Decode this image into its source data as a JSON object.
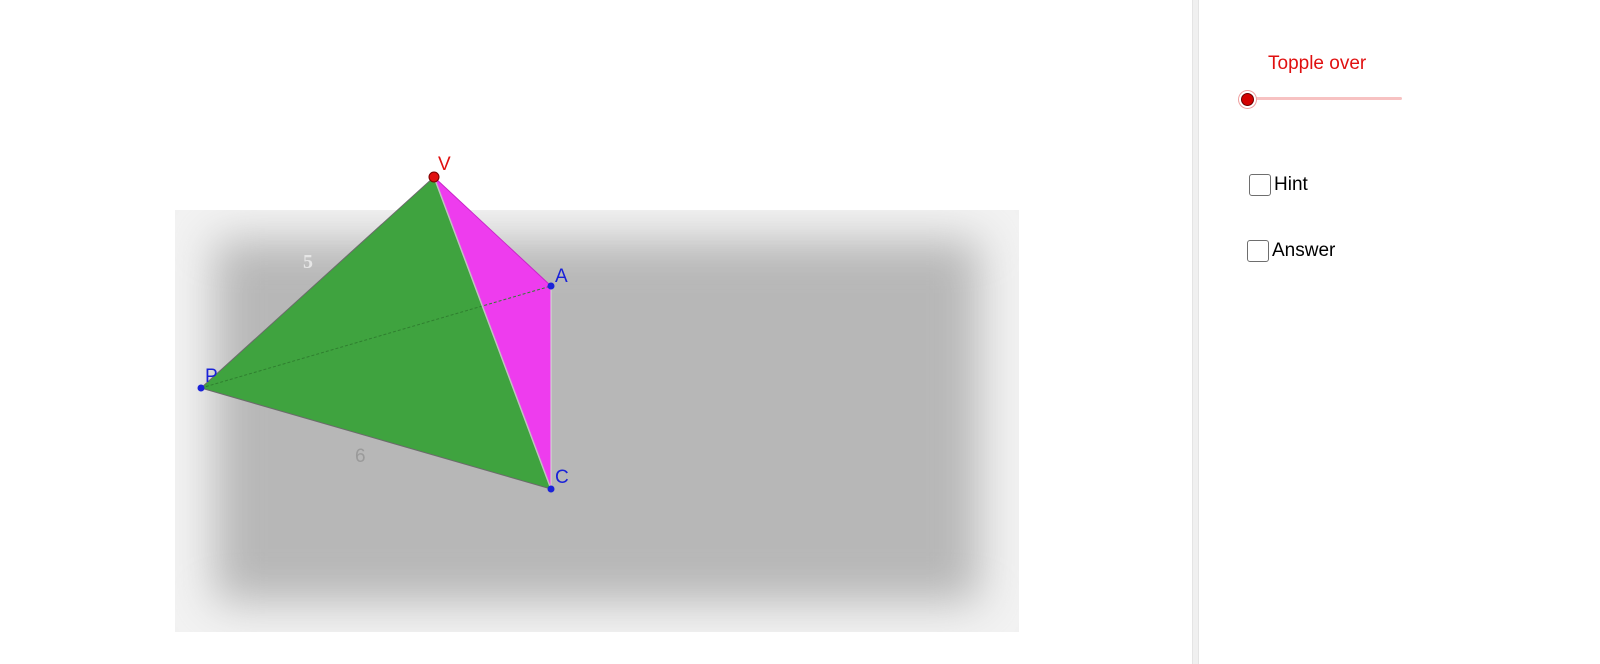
{
  "scene": {
    "edge_labels": {
      "vp": "5",
      "pc": "6"
    },
    "vertex_labels": {
      "v": "V",
      "a": "A",
      "p": "P",
      "c": "C"
    },
    "colors": {
      "front_face": "#3fa33f",
      "side_face": "#ee3cee",
      "base_plane": "#b7b7b7",
      "vertex_label_blue": "#1a22d8",
      "vertex_label_red": "#e01010",
      "edge_label_gray": "#9a9a9a"
    }
  },
  "controls": {
    "slider": {
      "label": "Topple over",
      "value": 0
    },
    "hint": {
      "label": "Hint",
      "checked": false
    },
    "answer": {
      "label": "Answer",
      "checked": false
    }
  }
}
